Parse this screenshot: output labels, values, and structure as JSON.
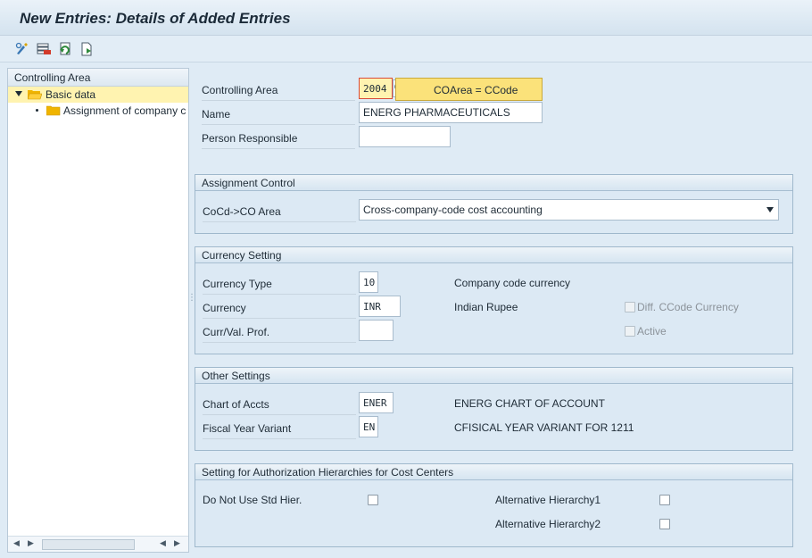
{
  "window": {
    "title": "New Entries: Details of Added Entries"
  },
  "toolbar": {
    "icons": [
      "display-change-icon",
      "delete-icon",
      "undo-change-icon",
      "copy-icon"
    ]
  },
  "tree": {
    "header": "Controlling Area",
    "items": [
      {
        "label": "Basic data",
        "expanded": true,
        "selected": true
      },
      {
        "label": "Assignment of company c"
      }
    ]
  },
  "header_fields": {
    "controlling_area": {
      "label": "Controlling Area",
      "value": "2004",
      "tooltip": "COArea = CCode"
    },
    "name": {
      "label": "Name",
      "value": "ENERG PHARMACEUTICALS"
    },
    "person_responsible": {
      "label": "Person Responsible",
      "value": ""
    }
  },
  "assignment_control": {
    "title": "Assignment Control",
    "cocd_label": "CoCd->CO Area",
    "cocd_value": "Cross-company-code cost accounting"
  },
  "currency_setting": {
    "title": "Currency Setting",
    "currency_type": {
      "label": "Currency Type",
      "value": "10",
      "desc": "Company code currency"
    },
    "currency": {
      "label": "Currency",
      "value": "INR",
      "desc": "Indian Rupee"
    },
    "curr_val_prof": {
      "label": "Curr/Val. Prof.",
      "value": ""
    },
    "diff_ccode_currency": {
      "label": "Diff. CCode Currency",
      "checked": false
    },
    "active": {
      "label": "Active",
      "checked": false
    }
  },
  "other_settings": {
    "title": "Other Settings",
    "chart_of_accts": {
      "label": "Chart of Accts",
      "value": "ENER",
      "desc": "ENERG CHART OF ACCOUNT"
    },
    "fiscal_year_variant": {
      "label": "Fiscal Year Variant",
      "value": "EN",
      "desc": "CFISICAL YEAR VARIANT FOR 1211"
    }
  },
  "auth_hierarchies": {
    "title": "Setting for Authorization Hierarchies for Cost Centers",
    "do_not_use_std": {
      "label": "Do Not Use Std Hier.",
      "checked": false
    },
    "alt_hier_1": {
      "label": "Alternative Hierarchy1",
      "checked": false
    },
    "alt_hier_2": {
      "label": "Alternative Hierarchy2",
      "checked": false
    }
  },
  "colors": {
    "background": "#dfebf5",
    "selection": "#fff3b0",
    "tooltip": "#fbe27a",
    "group_border": "#9fb8cc"
  }
}
